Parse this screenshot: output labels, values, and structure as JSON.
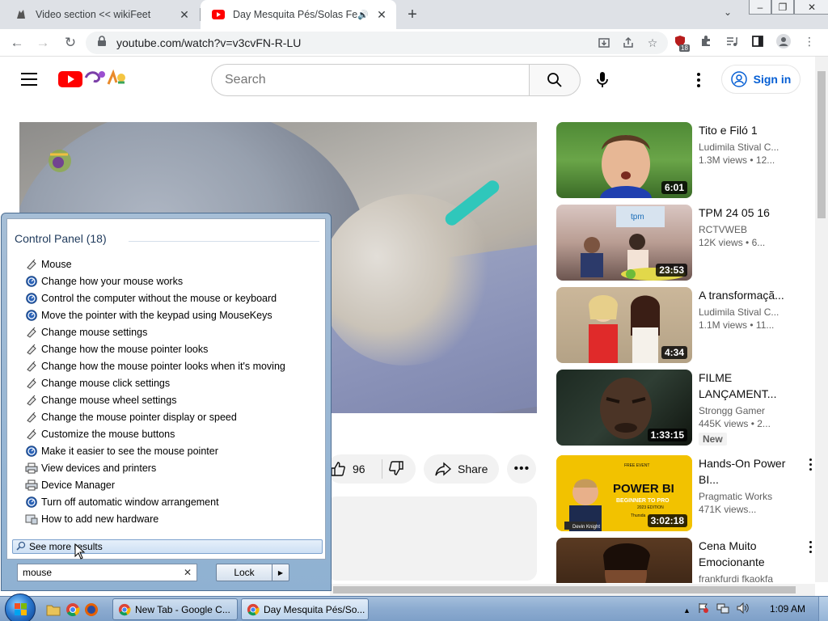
{
  "browser": {
    "tabs": [
      {
        "title": "Video section << wikiFeet",
        "active": false
      },
      {
        "title": "Day Mesquita Pés/Solas Feet",
        "active": true
      }
    ],
    "url": "youtube.com/watch?v=v3cvFN-R-LU",
    "extension_badge": "18"
  },
  "youtube": {
    "search_placeholder": "Search",
    "sign_in": "Sign in",
    "likes": "96",
    "share": "Share",
    "recommendations": [
      {
        "title": "Tito e Filó 1",
        "channel": "Ludimila Stival C...",
        "views": "1.3M views",
        "age": "• 12...",
        "duration": "6:01"
      },
      {
        "title": "TPM 24 05 16",
        "channel": "RCTVWEB",
        "views": "12K views",
        "age": "• 6...",
        "duration": "23:53"
      },
      {
        "title": "A transformaçã...",
        "channel": "Ludimila Stival C...",
        "views": "1.1M views",
        "age": "• 11...",
        "duration": "4:34"
      },
      {
        "title": "FILME LANÇAMENT...",
        "channel": "Strongg Gamer",
        "views": "445K views",
        "age": "• 2...",
        "duration": "1:33:15",
        "badge": "New"
      },
      {
        "title": "Hands-On Power BI...",
        "channel": "Pragmatic Works",
        "views": "471K views...",
        "age": "",
        "duration": "3:02:18",
        "thumb_text": {
          "headline": "POWER BI",
          "sub": "BEGINNER TO PRO",
          "edition": "2023 EDITION",
          "top": "FREE EVENT",
          "name": "Devin Knight",
          "day": "Thursda"
        }
      },
      {
        "title": "Cena Muito Emocionante",
        "channel": "frankfurdi fkaokfa",
        "views": "",
        "age": "",
        "duration": ""
      }
    ]
  },
  "startmenu": {
    "group_title": "Control Panel (18)",
    "items": [
      {
        "label": "Mouse",
        "icon": "mouse-icon"
      },
      {
        "label": "Change how your mouse works",
        "icon": "ease-of-access-icon"
      },
      {
        "label": "Control the computer without the mouse or keyboard",
        "icon": "ease-of-access-icon"
      },
      {
        "label": "Move the pointer with the keypad using MouseKeys",
        "icon": "ease-of-access-icon"
      },
      {
        "label": "Change mouse settings",
        "icon": "mouse-icon"
      },
      {
        "label": "Change how the mouse pointer looks",
        "icon": "mouse-icon"
      },
      {
        "label": "Change how the mouse pointer looks when it's moving",
        "icon": "mouse-icon"
      },
      {
        "label": "Change mouse click settings",
        "icon": "mouse-icon"
      },
      {
        "label": "Change mouse wheel settings",
        "icon": "mouse-icon"
      },
      {
        "label": "Change the mouse pointer display or speed",
        "icon": "mouse-icon"
      },
      {
        "label": "Customize the mouse buttons",
        "icon": "mouse-icon"
      },
      {
        "label": "Make it easier to see the mouse pointer",
        "icon": "ease-of-access-icon"
      },
      {
        "label": "View devices and printers",
        "icon": "printer-icon"
      },
      {
        "label": "Device Manager",
        "icon": "printer-icon"
      },
      {
        "label": "Turn off automatic window arrangement",
        "icon": "ease-of-access-icon"
      },
      {
        "label": "How to add new hardware",
        "icon": "hardware-icon"
      }
    ],
    "see_more": "See more results",
    "search_value": "mouse",
    "lock_label": "Lock"
  },
  "taskbar": {
    "tasks": [
      {
        "label": "New Tab - Google C..."
      },
      {
        "label": "Day Mesquita Pés/So..."
      }
    ],
    "clock": "1:09 AM"
  },
  "colors": {
    "youtube_red": "#ff0000",
    "signin_blue": "#065fd4",
    "chrome_frame": "#dee1e6"
  }
}
